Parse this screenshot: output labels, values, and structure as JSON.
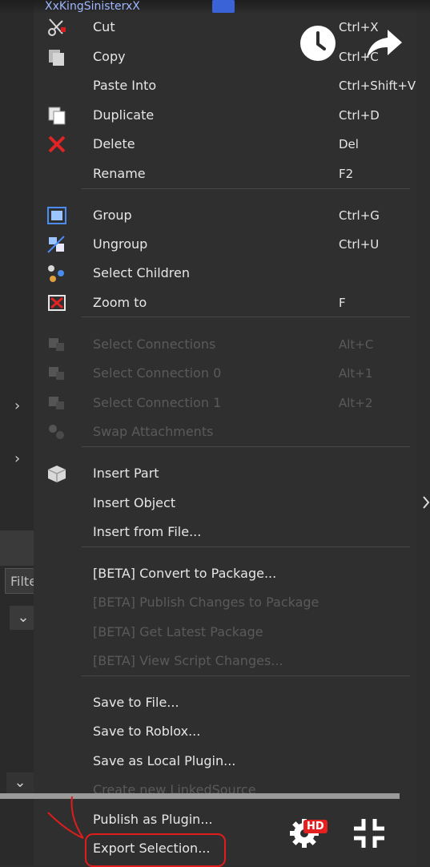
{
  "explorer_top": {
    "item_label": "XxKingSinisterxX"
  },
  "context_menu": {
    "items": [
      {
        "label": "Cut",
        "shortcut": "Ctrl+X",
        "icon": "scissors-icon",
        "enabled": true
      },
      {
        "label": "Copy",
        "shortcut": "Ctrl+C",
        "icon": "copy-icon",
        "enabled": true
      },
      {
        "label": "Paste Into",
        "shortcut": "Ctrl+Shift+V",
        "icon": "",
        "enabled": true
      },
      {
        "label": "Duplicate",
        "shortcut": "Ctrl+D",
        "icon": "duplicate-icon",
        "enabled": true
      },
      {
        "label": "Delete",
        "shortcut": "Del",
        "icon": "delete-x-icon",
        "enabled": true
      },
      {
        "label": "Rename",
        "shortcut": "F2",
        "icon": "",
        "enabled": true
      },
      {
        "label": "Group",
        "shortcut": "Ctrl+G",
        "icon": "group-icon",
        "enabled": true
      },
      {
        "label": "Ungroup",
        "shortcut": "Ctrl+U",
        "icon": "ungroup-icon",
        "enabled": true
      },
      {
        "label": "Select Children",
        "shortcut": "",
        "icon": "select-children-icon",
        "enabled": true
      },
      {
        "label": "Zoom to",
        "shortcut": "F",
        "icon": "zoom-to-icon",
        "enabled": true
      },
      {
        "label": "Select Connections",
        "shortcut": "Alt+C",
        "icon": "connections-icon",
        "enabled": false
      },
      {
        "label": "Select Connection 0",
        "shortcut": "Alt+1",
        "icon": "connection-0-icon",
        "enabled": false
      },
      {
        "label": "Select Connection 1",
        "shortcut": "Alt+2",
        "icon": "connection-1-icon",
        "enabled": false
      },
      {
        "label": "Swap Attachments",
        "shortcut": "",
        "icon": "swap-attachments-icon",
        "enabled": false
      },
      {
        "label": "Insert Part",
        "shortcut": "",
        "icon": "part-cube-icon",
        "enabled": true
      },
      {
        "label": "Insert Object",
        "shortcut": "",
        "icon": "",
        "enabled": true
      },
      {
        "label": "Insert from File...",
        "shortcut": "",
        "icon": "",
        "enabled": true
      },
      {
        "label": "[BETA] Convert to Package...",
        "shortcut": "",
        "icon": "",
        "enabled": true
      },
      {
        "label": "[BETA] Publish Changes to Package",
        "shortcut": "",
        "icon": "",
        "enabled": false
      },
      {
        "label": "[BETA] Get Latest Package",
        "shortcut": "",
        "icon": "",
        "enabled": false
      },
      {
        "label": "[BETA] View Script Changes...",
        "shortcut": "",
        "icon": "",
        "enabled": false
      },
      {
        "label": "Save to File...",
        "shortcut": "",
        "icon": "",
        "enabled": true
      },
      {
        "label": "Save to Roblox...",
        "shortcut": "",
        "icon": "",
        "enabled": true
      },
      {
        "label": "Save as Local Plugin...",
        "shortcut": "",
        "icon": "",
        "enabled": true
      },
      {
        "label": "Create new LinkedSource",
        "shortcut": "",
        "icon": "",
        "enabled": false
      },
      {
        "label": "Publish as Plugin...",
        "shortcut": "",
        "icon": "",
        "enabled": true
      },
      {
        "label": "Export Selection...",
        "shortcut": "",
        "icon": "",
        "enabled": true
      }
    ]
  },
  "left_panel": {
    "filter_placeholder": "Filter"
  },
  "video_overlay": {
    "hd_badge": "HD",
    "accent_red": "#e52020",
    "annotation_color": "#e01c1c",
    "progress_fraction": 0.93
  }
}
